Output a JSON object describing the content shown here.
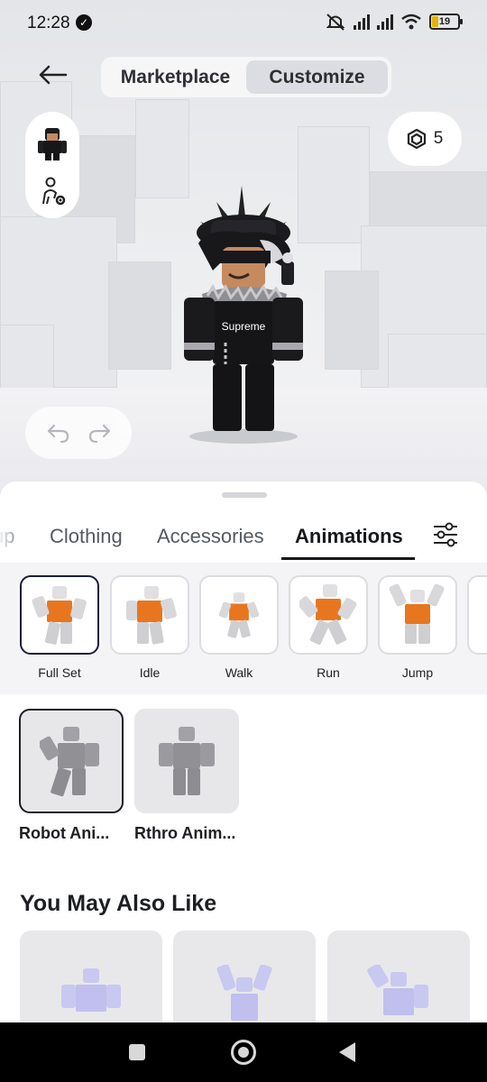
{
  "status_bar": {
    "time": "12:28",
    "battery": "19",
    "icons": [
      "verified-badge-icon",
      "mute-icon",
      "signal-icon",
      "signal-icon",
      "wifi-icon",
      "battery-icon"
    ]
  },
  "header": {
    "back_icon": "arrow-left-icon",
    "tabs": [
      {
        "label": "Marketplace",
        "active": false
      },
      {
        "label": "Customize",
        "active": true
      }
    ]
  },
  "robux": {
    "icon": "robux-icon",
    "amount": "5"
  },
  "side_controls": {
    "items": [
      "avatar-thumbnail",
      "avatar-settings-icon"
    ]
  },
  "history": {
    "undo_icon": "undo-icon",
    "redo_icon": "redo-icon"
  },
  "category_tabs": {
    "items": [
      {
        "label": "up",
        "active": false
      },
      {
        "label": "Clothing",
        "active": false
      },
      {
        "label": "Accessories",
        "active": false
      },
      {
        "label": "Animations",
        "active": true
      }
    ],
    "filter_icon": "sliders-icon"
  },
  "animation_types": [
    {
      "label": "Full Set",
      "selected": true
    },
    {
      "label": "Idle",
      "selected": false
    },
    {
      "label": "Walk",
      "selected": false
    },
    {
      "label": "Run",
      "selected": false
    },
    {
      "label": "Jump",
      "selected": false
    }
  ],
  "packs": [
    {
      "name": "Robot Ani...",
      "selected": true
    },
    {
      "name": "Rthro Anim...",
      "selected": false
    }
  ],
  "recommendations": {
    "title": "You May Also Like",
    "count_visible": 3
  },
  "colors": {
    "accent_dark": "#1b1d3a",
    "orange_shirt": "#e8761f",
    "lavender_figure": "#c9c8f0"
  }
}
